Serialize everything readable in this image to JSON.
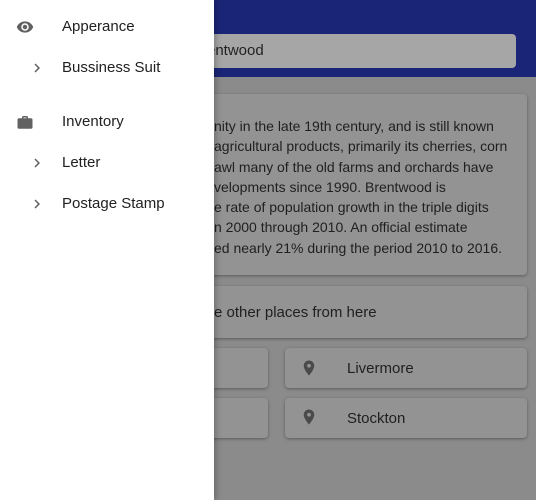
{
  "search": {
    "value": "rentwood"
  },
  "description": {
    "lines": [
      "nity in the late 19th century, and is still known",
      "agricultural products, primarily its cherries, corn",
      "awl many of the old farms and orchards have",
      "velopments since 1990. Brentwood is",
      "e rate of population growth in the triple digits",
      "n 2000 through 2010. An official estimate",
      "ed nearly 21% during the period 2010 to 2016."
    ]
  },
  "explore": {
    "label": "e other places from here"
  },
  "places": [
    {
      "name": "Livermore",
      "icon": "location-pin-icon"
    },
    {
      "name": "Stockton",
      "icon": "location-pin-icon"
    }
  ],
  "drawer": {
    "items": [
      {
        "label": "Apperance",
        "icon": "eye-icon",
        "type": "section"
      },
      {
        "label": "Bussiness Suit",
        "icon": "chevron-right-icon",
        "type": "child"
      },
      {
        "label": "Inventory",
        "icon": "briefcase-icon",
        "type": "section"
      },
      {
        "label": "Letter",
        "icon": "chevron-right-icon",
        "type": "child"
      },
      {
        "label": "Postage Stamp",
        "icon": "chevron-right-icon",
        "type": "child"
      }
    ]
  },
  "colors": {
    "appbar": "#1b2577",
    "scrim_bg": "#8b8b8b",
    "drawer_bg": "#ffffff",
    "icon": "#616161"
  }
}
